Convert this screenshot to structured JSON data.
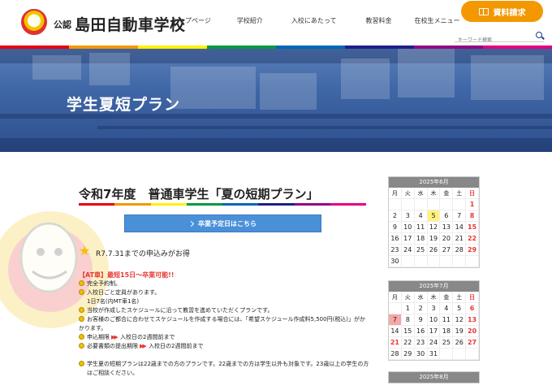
{
  "header": {
    "logo_small": "公認",
    "logo_name": "島田自動車学校",
    "nav": [
      "トップページ",
      "学校紹介",
      "入校にあたって",
      "教習料金",
      "在校生メニュー"
    ],
    "request_button": "資料請求",
    "search_placeholder": "キーワード検索"
  },
  "hero": {
    "title": "学生夏短プラン"
  },
  "main": {
    "title": "令和7年度　普通車学生「夏の短期プラン」",
    "graduation_button": "卒業予定日はこちら",
    "deadline": "R7.7.31までの申込みがお得",
    "lines": {
      "at_headline": "【AT車】最短15日～卒業可能!!",
      "l1": "完全予約制。",
      "l2": "入校日ごと定員があります。",
      "l3": "1日7名(内MT車1名)",
      "l4": "当校が作成したスケジュールに沿って教習を進めていただくプランです。",
      "l5a": "お客様のご都合に合わせてスケジュールを作成する場合には、「希望スケジュール作成料5,500円(税込)」がか",
      "l5b": "かります。",
      "l6_label": "申込期限",
      "l6_value": "入校日の2週間前まで",
      "l7_label": "必要書類の提出期限",
      "l7_value": "入校日の2週間前まで",
      "l8a": "学生夏の短期プランは22歳までの方のプランです。22歳までの方は学生以外も対象です。23歳以上の学生の方",
      "l8b": "はご相談ください。"
    }
  },
  "calendar": {
    "weekdays": [
      "月",
      "火",
      "水",
      "木",
      "金",
      "土",
      "日"
    ],
    "june": {
      "title": "2025年6月",
      "rows": [
        [
          "",
          "",
          "",
          "",
          "",
          "",
          "1"
        ],
        [
          "2",
          "3",
          "4",
          "5",
          "6",
          "7",
          "8"
        ],
        [
          "9",
          "10",
          "11",
          "12",
          "13",
          "14",
          "15"
        ],
        [
          "16",
          "17",
          "18",
          "19",
          "20",
          "21",
          "22"
        ],
        [
          "23",
          "24",
          "25",
          "26",
          "27",
          "28",
          "29"
        ],
        [
          "30",
          "",
          "",
          "",
          "",
          "",
          ""
        ]
      ]
    },
    "july": {
      "title": "2025年7月",
      "rows": [
        [
          "",
          "1",
          "2",
          "3",
          "4",
          "5",
          "6"
        ],
        [
          "7",
          "8",
          "9",
          "10",
          "11",
          "12",
          "13"
        ],
        [
          "14",
          "15",
          "16",
          "17",
          "18",
          "19",
          "20"
        ],
        [
          "21",
          "22",
          "23",
          "24",
          "25",
          "26",
          "27"
        ],
        [
          "28",
          "29",
          "30",
          "31",
          "",
          "",
          ""
        ]
      ]
    },
    "august": {
      "title": "2025年8月"
    }
  },
  "colors": {
    "accent_orange": "#f39800",
    "button_blue": "#4a90d9",
    "rainbow": [
      "#e60012",
      "#f39800",
      "#fff100",
      "#009944",
      "#0068b7",
      "#1d2088",
      "#920783",
      "#e4007f"
    ]
  }
}
